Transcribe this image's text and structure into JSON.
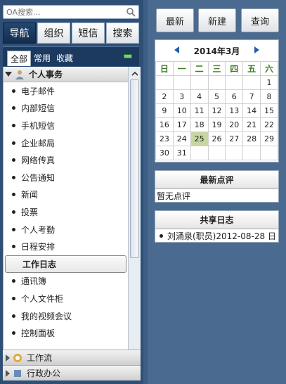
{
  "search": {
    "placeholder": "OA搜索..."
  },
  "tabs": [
    {
      "label": "导航",
      "active": true
    },
    {
      "label": "组织",
      "active": false
    },
    {
      "label": "短信",
      "active": false
    },
    {
      "label": "搜索",
      "active": false
    }
  ],
  "subtabs": [
    {
      "label": "全部",
      "active": true
    },
    {
      "label": "常用",
      "active": false
    },
    {
      "label": "收藏",
      "active": false
    }
  ],
  "tree": {
    "group": "个人事务",
    "items": [
      "电子邮件",
      "内部短信",
      "手机短信",
      "企业邮局",
      "网络传真",
      "公告通知",
      "新闻",
      "投票",
      "个人考勤",
      "日程安排",
      "工作日志",
      "通讯簿",
      "个人文件柜",
      "我的视频会议",
      "控制面板"
    ],
    "selected": "工作日志"
  },
  "lower": {
    "group1": "工作流",
    "group2": "行政办公"
  },
  "toolbar": {
    "latest": "最新",
    "new": "新建",
    "query": "查询"
  },
  "calendar": {
    "title": "2014年3月",
    "weekdays": [
      "日",
      "一",
      "二",
      "三",
      "四",
      "五",
      "六"
    ],
    "weeks": [
      [
        "",
        "",
        "",
        "",
        "",
        "",
        "1"
      ],
      [
        "2",
        "3",
        "4",
        "5",
        "6",
        "7",
        "8"
      ],
      [
        "9",
        "10",
        "11",
        "12",
        "13",
        "14",
        "15"
      ],
      [
        "16",
        "17",
        "18",
        "19",
        "20",
        "21",
        "22"
      ],
      [
        "23",
        "24",
        "25",
        "26",
        "27",
        "28",
        "29"
      ],
      [
        "30",
        "31",
        "",
        "",
        "",
        "",
        ""
      ]
    ],
    "today": "25"
  },
  "reviews": {
    "title": "最新点评",
    "empty_text": "暂无点评"
  },
  "shared": {
    "title": "共享日志",
    "entry": "刘涌泉(职员)2012-08-28 日"
  }
}
